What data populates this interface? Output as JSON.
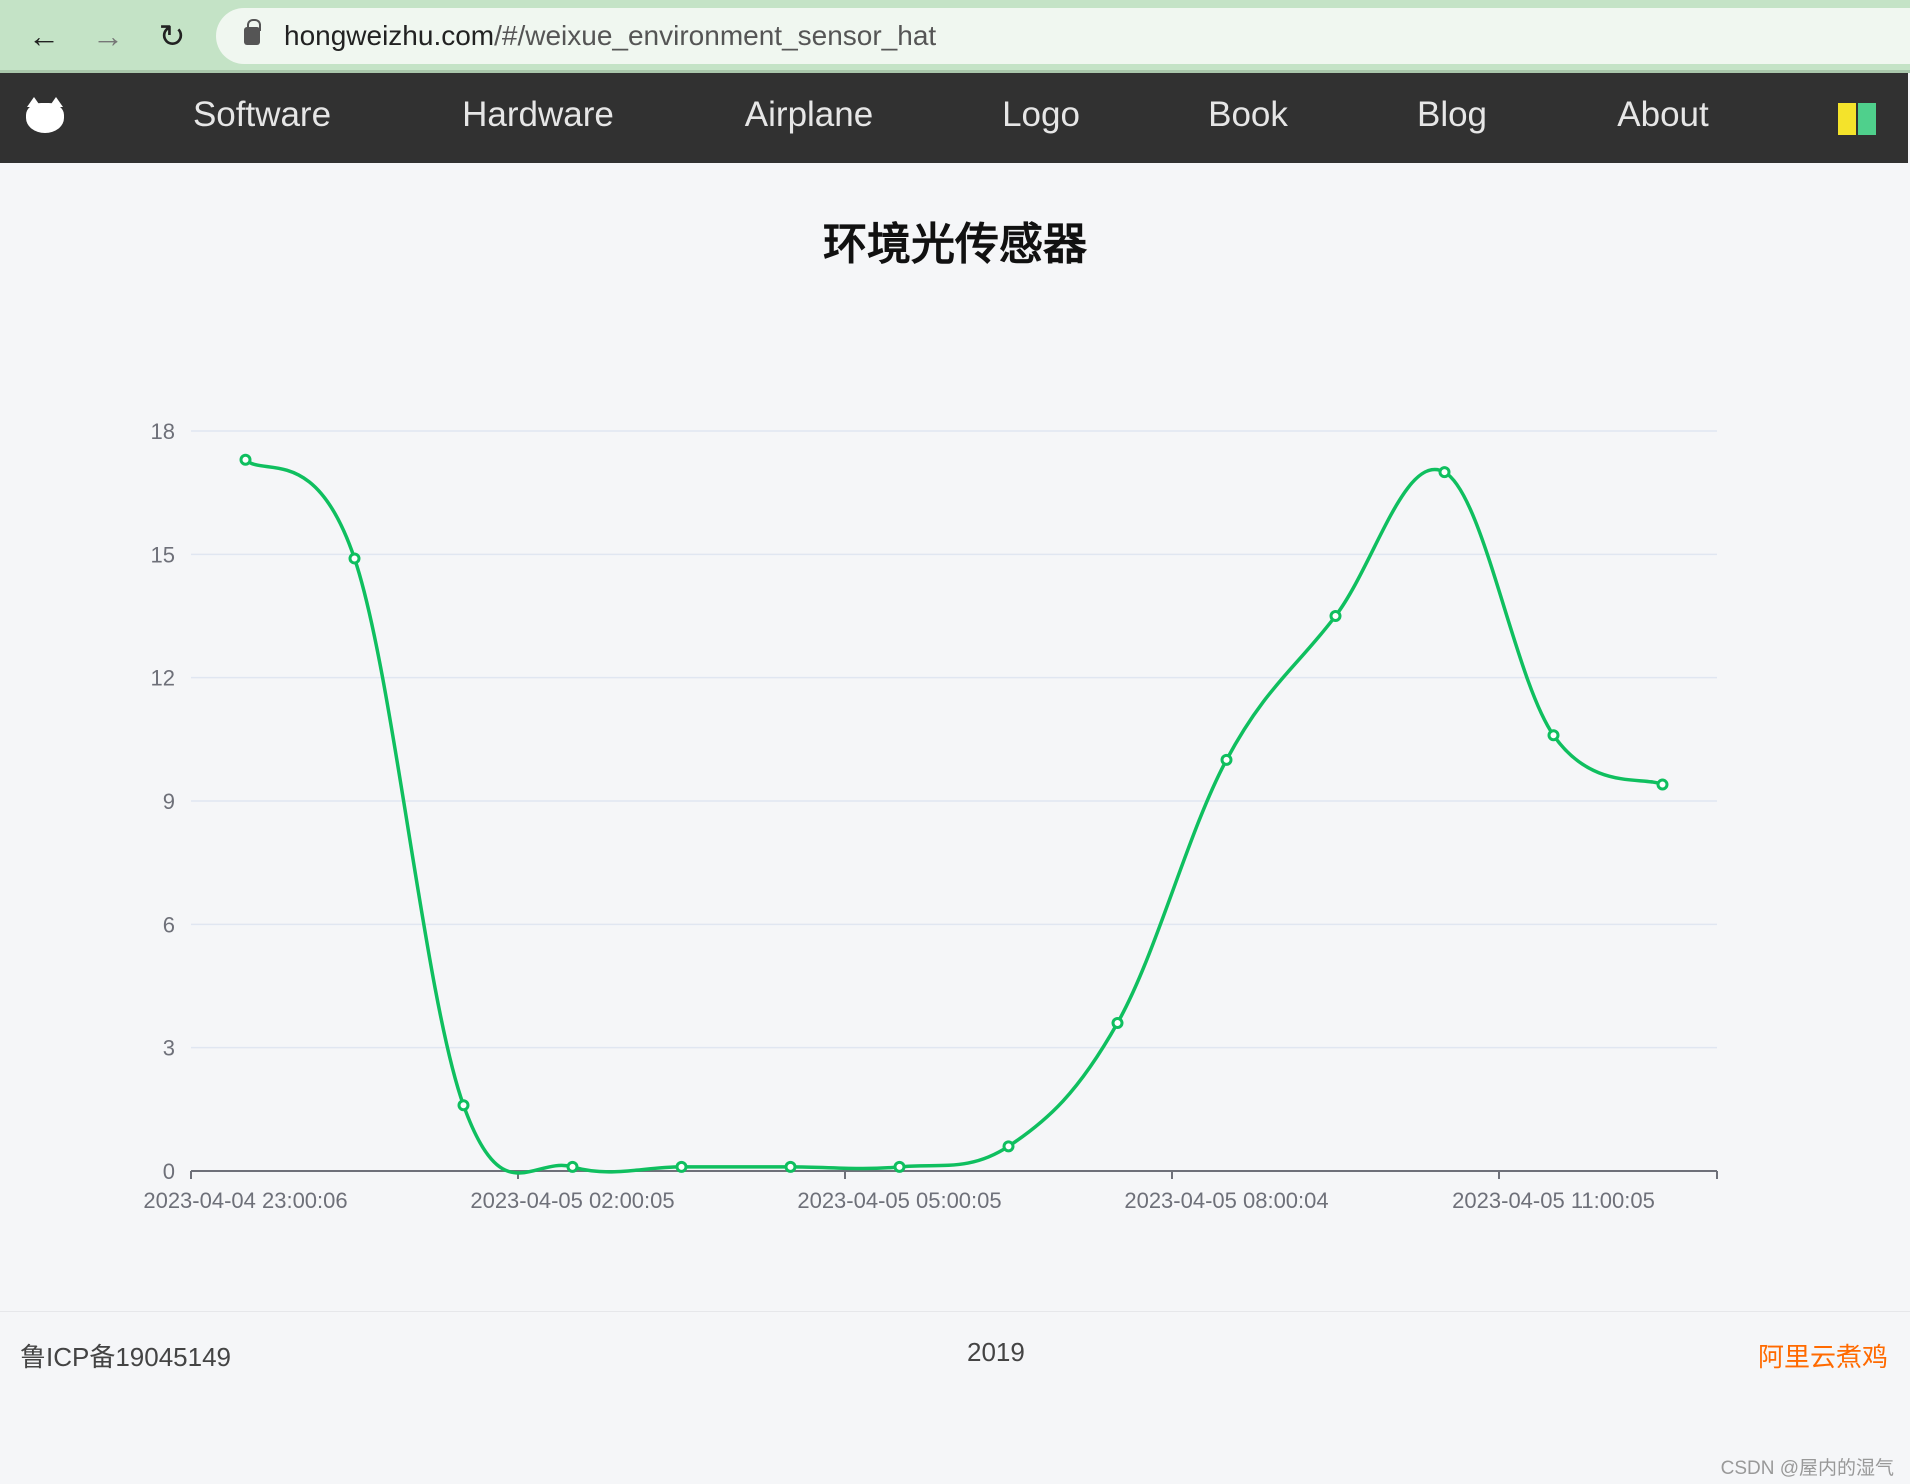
{
  "browser": {
    "url_host": "hongweizhu.com",
    "url_path": "/#/weixue_environment_sensor_hat"
  },
  "nav": {
    "items": [
      {
        "label": "Software"
      },
      {
        "label": "Hardware"
      },
      {
        "label": "Airplane"
      },
      {
        "label": "Logo"
      },
      {
        "label": "Book"
      },
      {
        "label": "Blog"
      },
      {
        "label": "About"
      }
    ]
  },
  "page": {
    "title": "环境光传感器"
  },
  "chart_data": {
    "type": "line",
    "smooth": true,
    "color": "#0fbf5f",
    "x_tick_labels": [
      "2023-04-04 23:00:06",
      "2023-04-05 02:00:05",
      "2023-04-05 05:00:05",
      "2023-04-05 08:00:04",
      "2023-04-05 11:00:05"
    ],
    "x_tick_label_every": 3,
    "values": [
      17.3,
      14.9,
      1.6,
      0.1,
      0.1,
      0.1,
      0.1,
      0.6,
      3.6,
      10.0,
      13.5,
      17.0,
      10.6,
      9.4
    ],
    "yticks": [
      0,
      3,
      6,
      9,
      12,
      15,
      18
    ],
    "ylim": [
      0,
      18
    ],
    "grid": true
  },
  "footer": {
    "icp": "鲁ICP备19045149",
    "year": "2019",
    "right_link": "阿里云煮鸡",
    "link_color": "#ff6a00"
  },
  "watermark": "CSDN @屋内的湿气"
}
